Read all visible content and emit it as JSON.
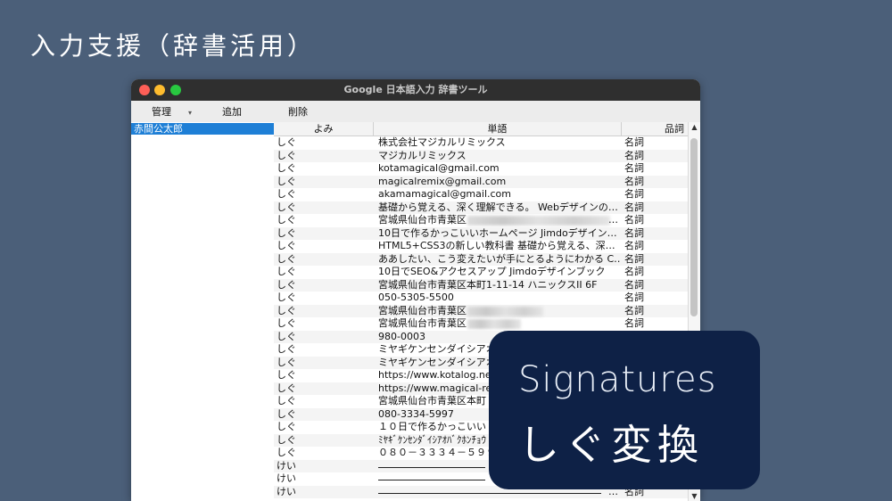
{
  "slide_title": "入力支援（辞書活用）",
  "window": {
    "title": "Google 日本語入力 辞書ツール",
    "toolbar": {
      "manage": "管理",
      "manage_caret": "▾",
      "add": "追加",
      "delete": "削除"
    }
  },
  "dictionaries": [
    "赤間公太郎"
  ],
  "table": {
    "headers": {
      "yomi": "よみ",
      "word": "単語",
      "pos": "品詞"
    },
    "rows": [
      {
        "yomi": "しぐ",
        "word": "株式会社マジカルリミックス",
        "pos": "名詞"
      },
      {
        "yomi": "しぐ",
        "word": "マジカルリミックス",
        "pos": "名詞"
      },
      {
        "yomi": "しぐ",
        "word": "kotamagical@gmail.com",
        "pos": "名詞"
      },
      {
        "yomi": "しぐ",
        "word": "magicalremix@gmail.com",
        "pos": "名詞"
      },
      {
        "yomi": "しぐ",
        "word": "akamamagical@gmail.com",
        "pos": "名詞"
      },
      {
        "yomi": "しぐ",
        "word": "基礎から覚える、深く理解できる。 Webデザインの…",
        "pos": "名詞"
      },
      {
        "yomi": "しぐ",
        "word": "宮城県仙台市青葉区",
        "pos": "名詞",
        "blur": 160,
        "ellipsis": "…"
      },
      {
        "yomi": "しぐ",
        "word": "10日で作るかっこいいホームページ Jimdoデザイン…",
        "pos": "名詞"
      },
      {
        "yomi": "しぐ",
        "word": "HTML5+CSS3の新しい教科書 基礎から覚える、深…",
        "pos": "名詞"
      },
      {
        "yomi": "しぐ",
        "word": "ああしたい、こう変えたいが手にとるようにわかる C…",
        "pos": "名詞"
      },
      {
        "yomi": "しぐ",
        "word": "10日でSEO&アクセスアップ Jimdoデザインブック",
        "pos": "名詞"
      },
      {
        "yomi": "しぐ",
        "word": "宮城県仙台市青葉区本町1-11-14 ハニックスII 6F",
        "pos": "名詞"
      },
      {
        "yomi": "しぐ",
        "word": "050-5305-5500",
        "pos": "名詞"
      },
      {
        "yomi": "しぐ",
        "word": "宮城県仙台市青葉区",
        "pos": "名詞",
        "blur": 85
      },
      {
        "yomi": "しぐ",
        "word": "宮城県仙台市青葉区",
        "pos": "名詞",
        "blur": 60
      },
      {
        "yomi": "しぐ",
        "word": "980-0003",
        "pos": ""
      },
      {
        "yomi": "しぐ",
        "word": "ミヤギケンセンダイシアオ",
        "pos": ""
      },
      {
        "yomi": "しぐ",
        "word": "ミヤギケンセンダイシアオ",
        "pos": ""
      },
      {
        "yomi": "しぐ",
        "word": "https://www.kotalog.ne",
        "pos": ""
      },
      {
        "yomi": "しぐ",
        "word": "https://www.magical-re",
        "pos": ""
      },
      {
        "yomi": "しぐ",
        "word": "宮城県仙台市青葉区本町",
        "pos": ""
      },
      {
        "yomi": "しぐ",
        "word": "080-3334-5997",
        "pos": ""
      },
      {
        "yomi": "しぐ",
        "word": "１０日で作るかっこいい",
        "pos": ""
      },
      {
        "yomi": "しぐ",
        "word": "ﾐﾔｷﾞｹﾝｾﾝﾀﾞｲｼｱｵﾊﾞｸﾎﾝﾁｮｳ",
        "pos": ""
      },
      {
        "yomi": "しぐ",
        "word": "０８０－３３３４－５９９",
        "pos": ""
      },
      {
        "yomi": "けい",
        "word": "",
        "pos": "",
        "underline": 120
      },
      {
        "yomi": "けい",
        "word": "",
        "pos": "",
        "underline": 120
      },
      {
        "yomi": "けい",
        "word": "",
        "pos": "名詞",
        "underline": 250,
        "ellipsis": "…"
      }
    ]
  },
  "overlay": {
    "line1": "Signatures",
    "line2": "しぐ変換"
  },
  "scroll": {
    "up": "▲",
    "down": "▼"
  }
}
